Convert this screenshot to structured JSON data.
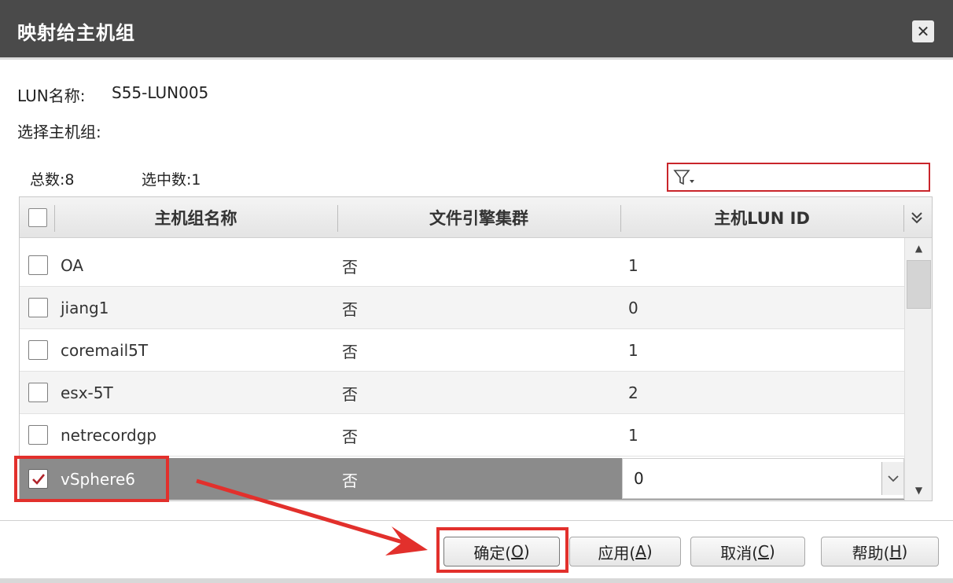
{
  "dialog": {
    "title": "映射给主机组",
    "close_glyph": "✕"
  },
  "info": {
    "lun_label": "LUN名称:",
    "lun_value": "S55-LUN005",
    "select_label": "选择主机组:",
    "total": "总数:8",
    "selected_count": "选中数:1"
  },
  "filter": {
    "value": "",
    "icon": "filter-icon"
  },
  "table": {
    "columns": [
      "主机组名称",
      "文件引擎集群",
      "主机LUN ID"
    ],
    "rows": [
      {
        "name": "OA",
        "cluster": "否",
        "lun_id": "1",
        "checked": false
      },
      {
        "name": "jiang1",
        "cluster": "否",
        "lun_id": "0",
        "checked": false
      },
      {
        "name": "coremail5T",
        "cluster": "否",
        "lun_id": "1",
        "checked": false
      },
      {
        "name": "esx-5T",
        "cluster": "否",
        "lun_id": "2",
        "checked": false
      },
      {
        "name": "netrecordgp",
        "cluster": "否",
        "lun_id": "1",
        "checked": false
      },
      {
        "name": "vSphere6",
        "cluster": "否",
        "lun_id": "0",
        "checked": true
      }
    ]
  },
  "buttons": {
    "ok": {
      "label": "确定(",
      "key": "O",
      "end": ")"
    },
    "apply": {
      "label": "应用(",
      "key": "A",
      "end": ")"
    },
    "cancel": {
      "label": "取消(",
      "key": "C",
      "end": ")"
    },
    "help": {
      "label": "帮助(",
      "key": "H",
      "end": ")"
    }
  },
  "colors": {
    "titlebar": "#4a4a4a",
    "highlight": "#e2302c",
    "selected_row": "#8b8b8b",
    "checkmark": "#b0232a"
  }
}
